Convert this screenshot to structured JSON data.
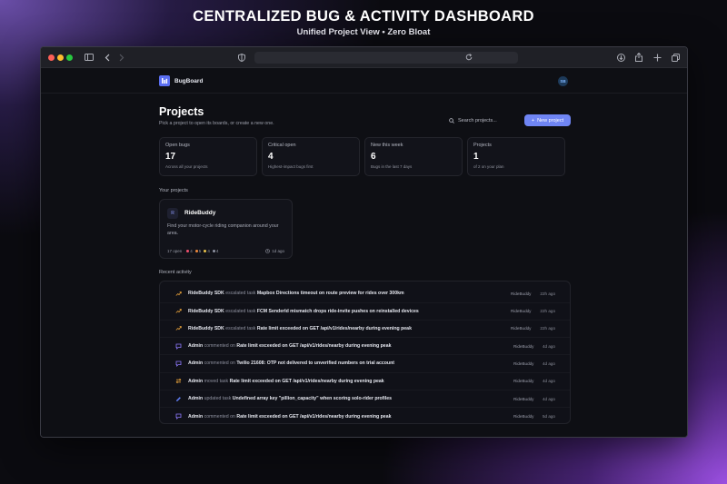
{
  "hero": {
    "title": "CENTRALIZED BUG & ACTIVITY DASHBOARD",
    "subtitle": "Unified Project View • Zero Bloat"
  },
  "app": {
    "name": "BugBoard",
    "avatar": "SB"
  },
  "page": {
    "title": "Projects",
    "subtitle": "Pick a project to open its boards, or create a new one."
  },
  "search": {
    "placeholder": "Search projects..."
  },
  "new_project": {
    "label": "New project"
  },
  "stats": [
    {
      "label": "Open bugs",
      "value": "17",
      "note": "Across all your projects"
    },
    {
      "label": "Critical open",
      "value": "4",
      "note": "Highest-impact bugs first"
    },
    {
      "label": "New this week",
      "value": "6",
      "note": "Bugs in the last 7 days"
    },
    {
      "label": "Projects",
      "value": "1",
      "note": "of 2 on your plan"
    }
  ],
  "your_projects": {
    "heading": "Your projects",
    "items": [
      {
        "icon": "R",
        "name": "RideBuddy",
        "description": "Find your motor-cycle riding companion around your area.",
        "open": "17 open",
        "critical": "4",
        "high": "5",
        "medium": "4",
        "low": "4",
        "updated": "1d ago",
        "colors": {
          "critical": "#f0506e",
          "high": "#f08a3c",
          "medium": "#e8c14a",
          "low": "#8f93a3"
        }
      }
    ]
  },
  "activity": {
    "heading": "Recent activity",
    "rows": [
      {
        "icon": "escalate-icon",
        "actor": "RideBuddy SDK",
        "verb": "escalated task",
        "target": "Mapbox Directions timeout on route preview for rides over 300km",
        "project": "RideBuddy",
        "time": "22h ago"
      },
      {
        "icon": "escalate-icon",
        "actor": "RideBuddy SDK",
        "verb": "escalated task",
        "target": "FCM SenderId mismatch drops ride-invite pushes on reinstalled devices",
        "project": "RideBuddy",
        "time": "22h ago"
      },
      {
        "icon": "escalate-icon",
        "actor": "RideBuddy SDK",
        "verb": "escalated task",
        "target": "Rate limit exceeded on GET /api/v1/rides/nearby during evening peak",
        "project": "RideBuddy",
        "time": "22h ago"
      },
      {
        "icon": "comment-icon",
        "actor": "Admin",
        "verb": "commented on",
        "target": "Rate limit exceeded on GET /api/v1/rides/nearby during evening peak",
        "project": "RideBuddy",
        "time": "4d ago"
      },
      {
        "icon": "comment-icon",
        "actor": "Admin",
        "verb": "commented on",
        "target": "Twilio 21608: OTP not delivered to unverified numbers on trial account",
        "project": "RideBuddy",
        "time": "4d ago"
      },
      {
        "icon": "move-icon",
        "actor": "Admin",
        "verb": "moved task",
        "target": "Rate limit exceeded on GET /api/v1/rides/nearby during evening peak",
        "project": "RideBuddy",
        "time": "4d ago"
      },
      {
        "icon": "edit-icon",
        "actor": "Admin",
        "verb": "updated task",
        "target": "Undefined array key \"pillion_capacity\" when scoring solo-rider profiles",
        "project": "RideBuddy",
        "time": "4d ago"
      },
      {
        "icon": "comment-icon",
        "actor": "Admin",
        "verb": "commented on",
        "target": "Rate limit exceeded on GET /api/v1/rides/nearby during evening peak",
        "project": "RideBuddy",
        "time": "5d ago"
      }
    ]
  }
}
